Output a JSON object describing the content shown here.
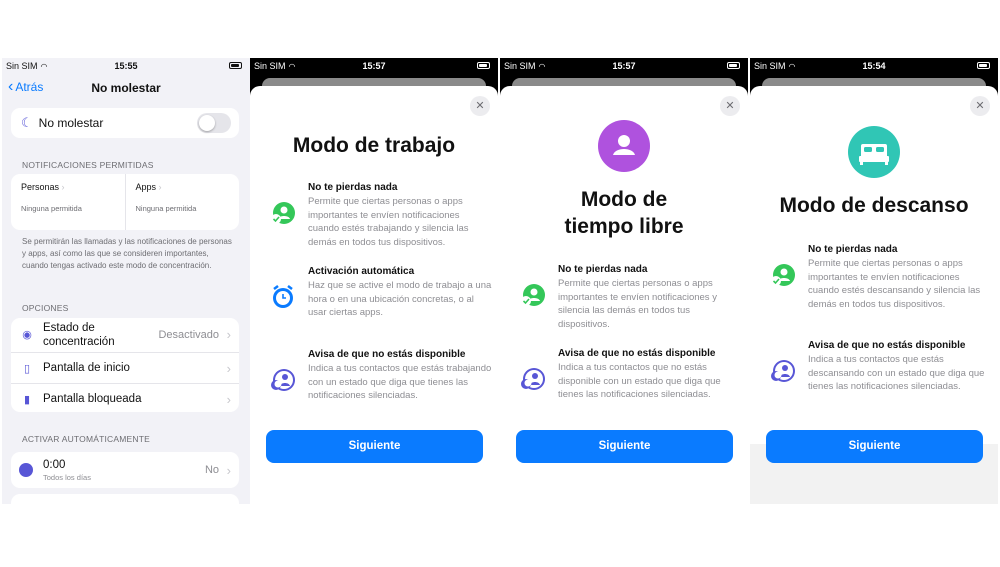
{
  "panel1": {
    "status": {
      "carrier": "Sin SIM",
      "time": "15:55"
    },
    "nav": {
      "back": "Atrás",
      "title": "No molestar"
    },
    "toggle_label": "No molestar",
    "allowed_header": "NOTIFICACIONES PERMITIDAS",
    "people": {
      "label": "Personas",
      "sub": "Ninguna permitida"
    },
    "apps": {
      "label": "Apps",
      "sub": "Ninguna permitida"
    },
    "note": "Se permitirán las llamadas y las notificaciones de personas y apps, así como las que se consideren importantes, cuando tengas activado este modo de concentración.",
    "options_header": "OPCIONES",
    "options": [
      {
        "label": "Estado de concentración",
        "value": "Desactivado"
      },
      {
        "label": "Pantalla de inicio",
        "value": ""
      },
      {
        "label": "Pantalla bloqueada",
        "value": ""
      }
    ],
    "auto_header": "ACTIVAR AUTOMÁTICAMENTE",
    "schedule": {
      "time": "0:00",
      "days": "Todos los días",
      "value": "No"
    }
  },
  "panel2": {
    "status": {
      "carrier": "Sin SIM",
      "time": "15:57"
    },
    "title": "Modo de trabajo",
    "features": [
      {
        "heading": "No te pierdas nada",
        "body": "Permite que ciertas personas o apps importantes te envíen notificaciones cuando estés trabajando y silencia las demás en todos tus dispositivos.",
        "icon": "people-check-icon"
      },
      {
        "heading": "Activación automática",
        "body": "Haz que se active el modo de trabajo a una hora o en una ubicación concretas, o al usar ciertas apps.",
        "icon": "alarm-clock-icon"
      },
      {
        "heading": "Avisa de que no estás disponible",
        "body": "Indica a tus contactos que estás trabajando con un estado que diga que tienes las notificaciones silenciadas.",
        "icon": "person-moon-icon"
      }
    ],
    "button": "Siguiente"
  },
  "panel3": {
    "status": {
      "carrier": "Sin SIM",
      "time": "15:57"
    },
    "title_line1": "Modo de",
    "title_line2": "tiempo libre",
    "hero_color": "#af52de",
    "features": [
      {
        "heading": "No te pierdas nada",
        "body": "Permite que ciertas personas o apps importantes te envíen notificaciones y silencia las demás en todos tus dispositivos.",
        "icon": "people-check-icon"
      },
      {
        "heading": "Avisa de que no estás disponible",
        "body": "Indica a tus contactos que no estás disponible con un estado que diga que tienes las notificaciones silenciadas.",
        "icon": "person-moon-icon"
      }
    ],
    "button": "Siguiente"
  },
  "panel4": {
    "status": {
      "carrier": "Sin SIM",
      "time": "15:54"
    },
    "title": "Modo de descanso",
    "hero_color": "#30c6b5",
    "features": [
      {
        "heading": "No te pierdas nada",
        "body": "Permite que ciertas personas o apps importantes te envíen notificaciones cuando estés descansando y silencia las demás en todos tus dispositivos.",
        "icon": "people-check-icon"
      },
      {
        "heading": "Avisa de que no estás disponible",
        "body": "Indica a tus contactos que estás descansando con un estado que diga que tienes las notificaciones silenciadas.",
        "icon": "person-moon-icon"
      }
    ],
    "button": "Siguiente"
  },
  "colors": {
    "accent": "#0a7bff",
    "green_icon": "#34c759",
    "purple_icon": "#5856d6"
  }
}
